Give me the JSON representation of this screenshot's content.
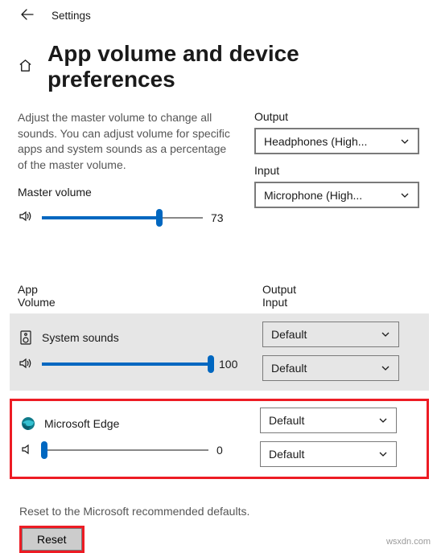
{
  "titlebar": {
    "settings": "Settings"
  },
  "page": {
    "title": "App volume and device preferences",
    "description": "Adjust the master volume to change all sounds. You can adjust volume for specific apps and system sounds as a percentage of the master volume.",
    "master_volume_label": "Master volume",
    "master_volume_value": "73",
    "master_volume_pct": 73
  },
  "devices": {
    "output_label": "Output",
    "output_value": "Headphones (High...",
    "input_label": "Input",
    "input_value": "Microphone (High..."
  },
  "columns": {
    "app_label": "App",
    "volume_label": "Volume",
    "output_label": "Output",
    "input_label": "Input"
  },
  "apps": [
    {
      "name": "System sounds",
      "volume": "100",
      "volume_pct": 100,
      "output": "Default",
      "input": "Default"
    },
    {
      "name": "Microsoft Edge",
      "volume": "0",
      "volume_pct": 0,
      "output": "Default",
      "input": "Default"
    }
  ],
  "reset": {
    "description": "Reset to the Microsoft recommended defaults.",
    "button": "Reset"
  },
  "watermark": "wsxdn.com"
}
